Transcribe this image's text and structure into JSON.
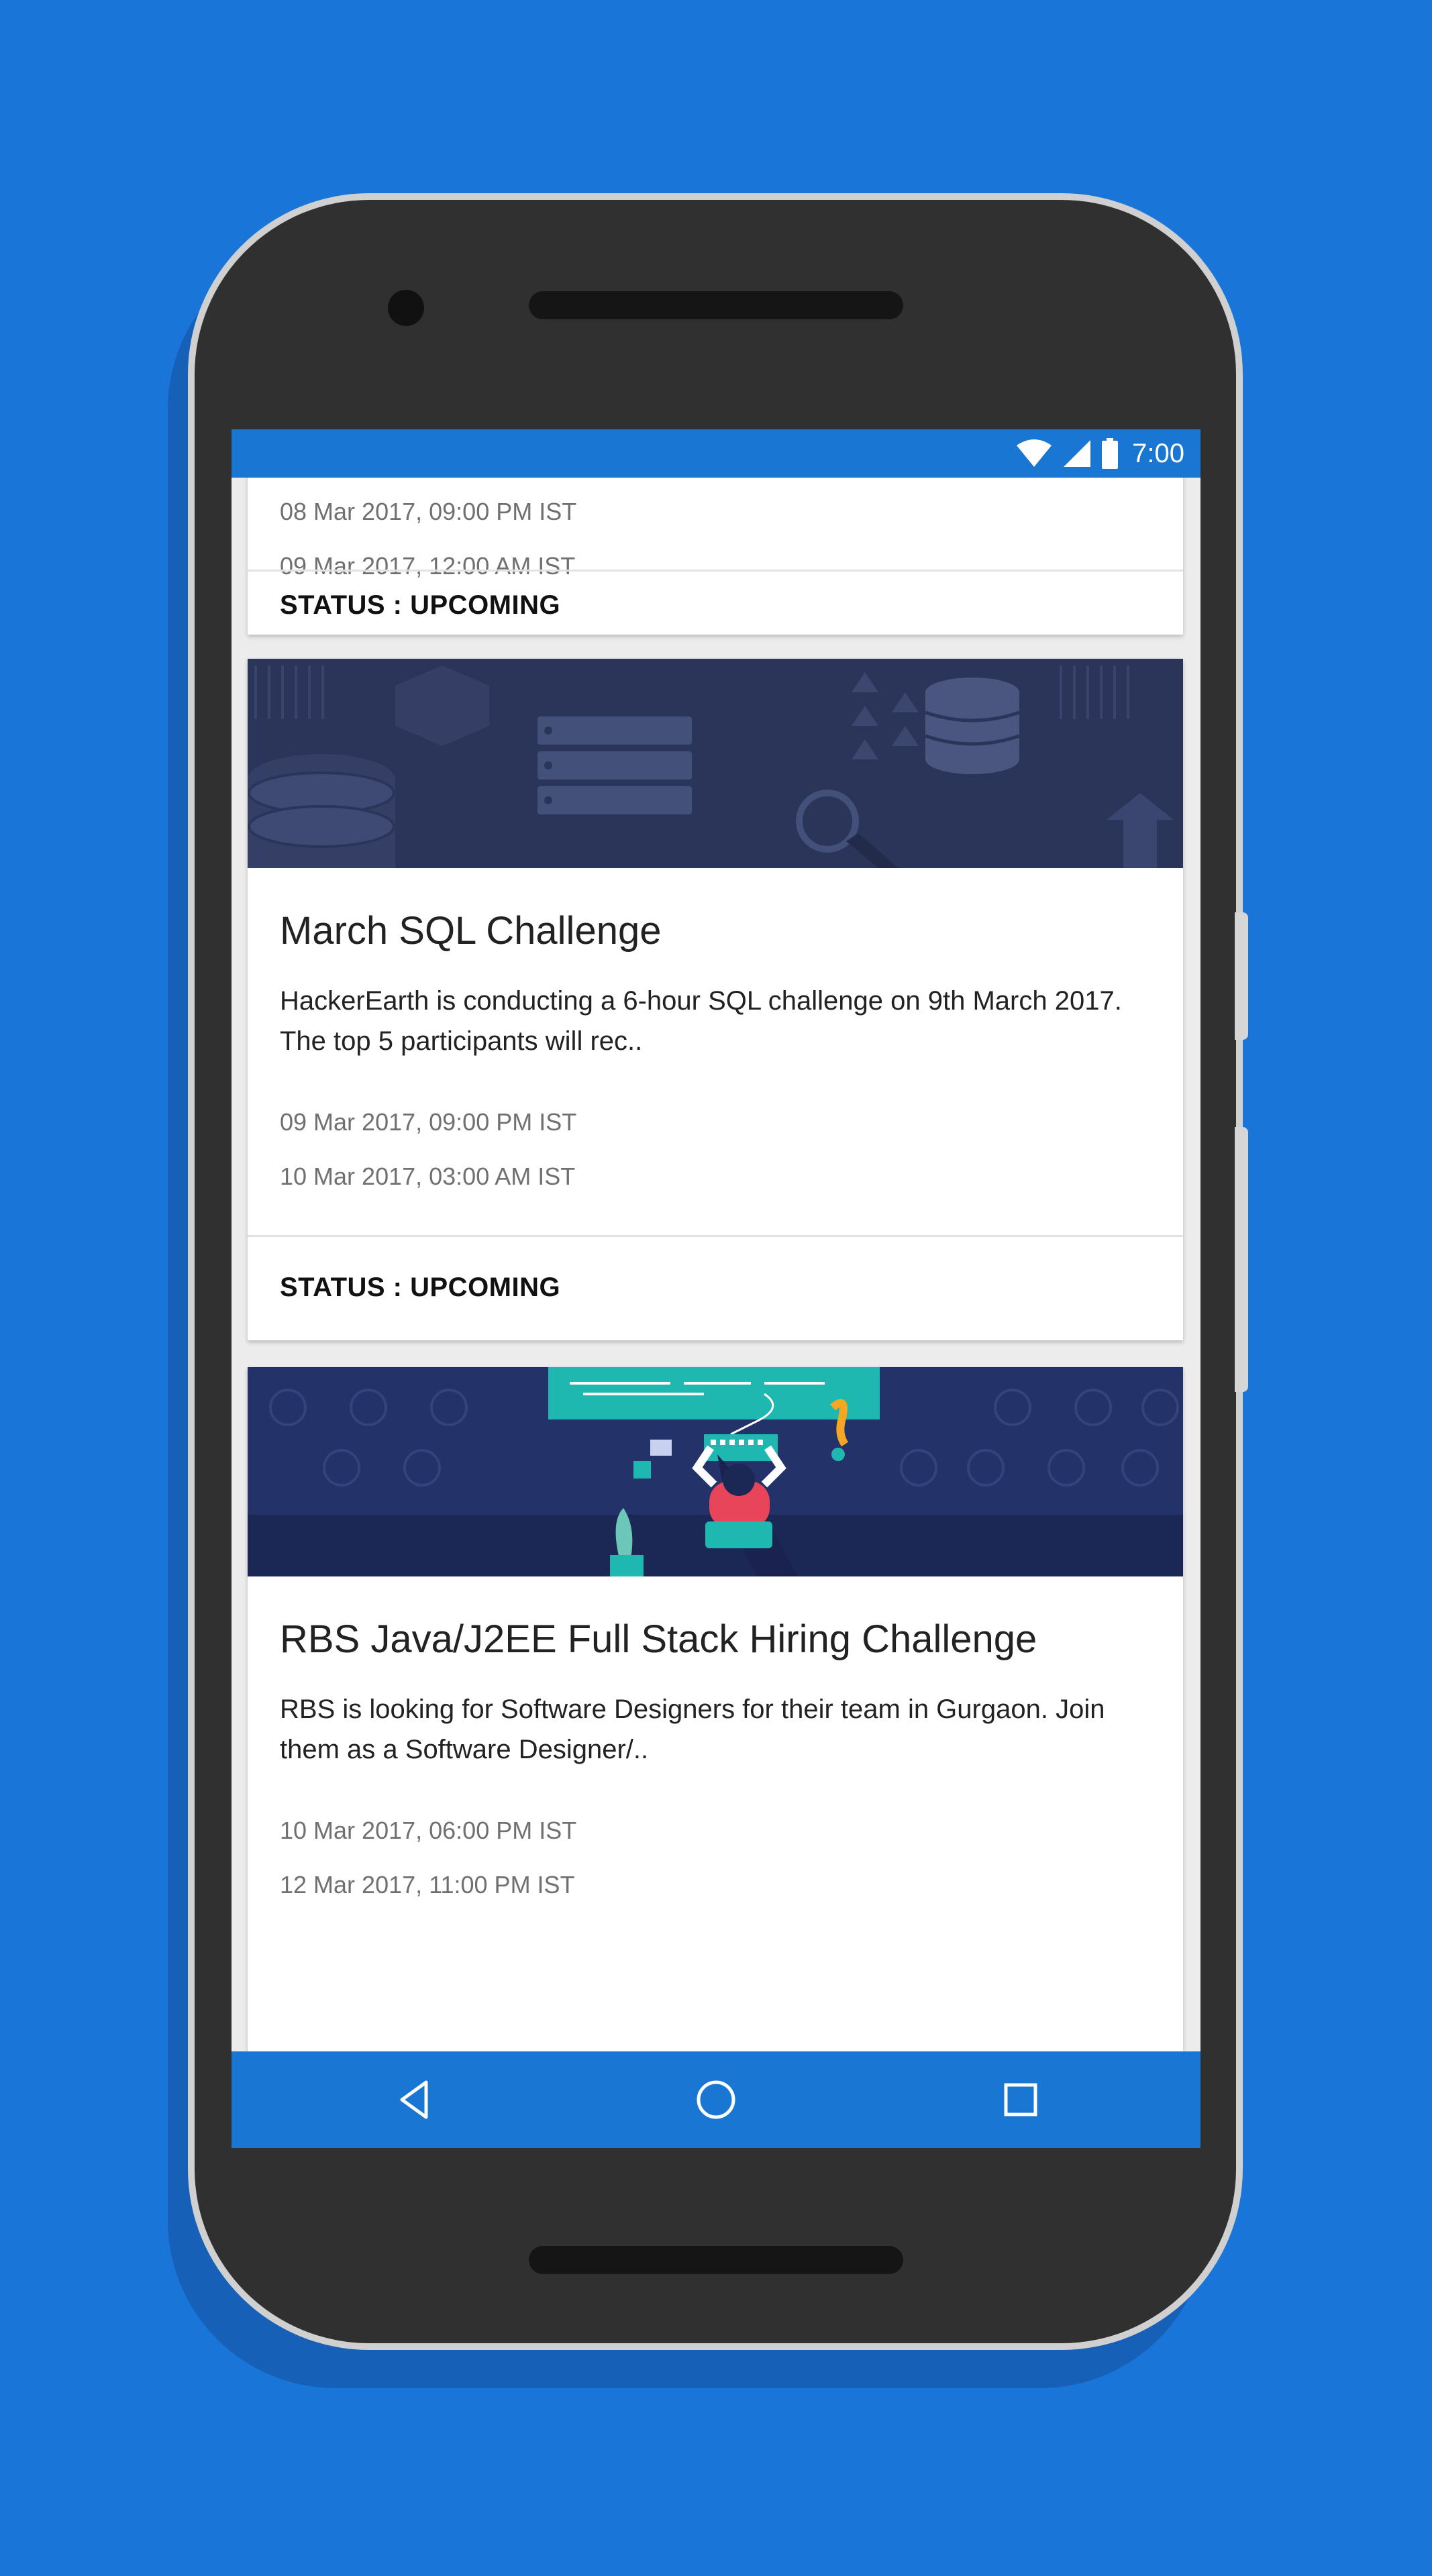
{
  "colors": {
    "background": "#1976D8",
    "status_bar": "#1976D2",
    "nav_bar": "#1976D2",
    "phone_body": "#303030",
    "banner_sql": "#2b3459",
    "banner_rbs": "#233269",
    "accent_teal": "#1fb8b0"
  },
  "status_bar": {
    "time": "7:00",
    "icons": [
      "wifi-icon",
      "signal-icon",
      "battery-icon"
    ]
  },
  "cards": [
    {
      "start": "08 Mar 2017, 09:00 PM IST",
      "end": "09 Mar 2017, 12:00 AM IST",
      "status": "STATUS : UPCOMING"
    },
    {
      "title": "March SQL Challenge",
      "description": "HackerEarth is conducting a 6-hour SQL challenge on 9th March 2017. The top 5 participants will rec..",
      "start": "09 Mar 2017, 09:00 PM IST",
      "end": "10 Mar 2017, 03:00 AM IST",
      "status": "STATUS : UPCOMING",
      "banner": "sql-database-illustration"
    },
    {
      "title": "RBS Java/J2EE Full Stack Hiring Challenge",
      "description": "RBS is looking for Software Designers for their team in Gurgaon. Join them as a Software Designer/..",
      "start": "10 Mar 2017, 06:00 PM IST",
      "end": "12 Mar 2017, 11:00 PM IST",
      "banner": "developer-at-desk-illustration"
    }
  ],
  "nav_bar": {
    "buttons": [
      "back-icon",
      "home-icon",
      "recents-icon"
    ]
  }
}
